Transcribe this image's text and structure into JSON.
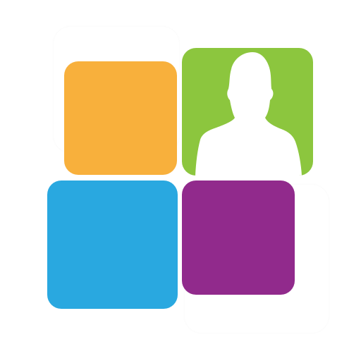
{
  "logo": {
    "tiles": [
      {
        "name": "orange-tile",
        "color": "#F8B03C"
      },
      {
        "name": "green-tile",
        "color": "#8CC63E"
      },
      {
        "name": "blue-tile",
        "color": "#29A8E0"
      },
      {
        "name": "purple-tile",
        "color": "#912A8C"
      }
    ],
    "silhouette_color": "#ffffff",
    "icon": "person-silhouette-icon"
  }
}
